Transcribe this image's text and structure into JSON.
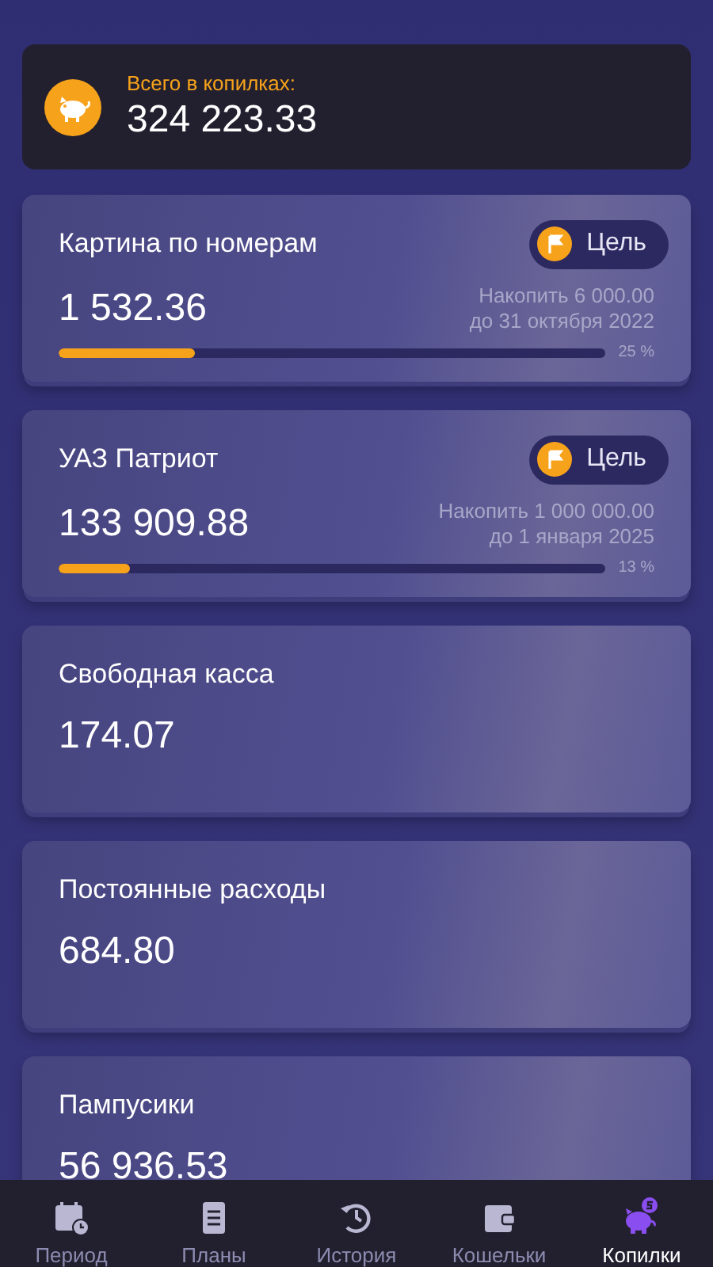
{
  "total": {
    "label": "Всего в копилках:",
    "amount": "324 223.33"
  },
  "jars": [
    {
      "kind": "goal",
      "name": "Картина по номерам",
      "badge": "Цель",
      "amount": "1 532.36",
      "target": "Накопить 6 000.00",
      "deadline": "до 31 октября 2022",
      "level": 0.25,
      "percent": "25 %"
    },
    {
      "kind": "goal",
      "name": "УАЗ Патриот",
      "badge": "Цель",
      "amount": "133 909.88",
      "target": "Накопить 1 000 000.00",
      "deadline": "до 1 января 2025",
      "level": 0.13,
      "percent": "13 %"
    },
    {
      "kind": "plain",
      "name": "Свободная касса",
      "amount": "174.07"
    },
    {
      "kind": "plain",
      "name": "Постоянные расходы",
      "amount": "684.80"
    },
    {
      "kind": "plain",
      "name": "Пампусики",
      "amount": "56 936.53"
    }
  ],
  "nav": [
    {
      "kind": "calendar",
      "label": "Период",
      "selected": false
    },
    {
      "kind": "document",
      "label": "Планы",
      "selected": false
    },
    {
      "kind": "history",
      "label": "История",
      "selected": false
    },
    {
      "kind": "wallet",
      "label": "Кошельки",
      "selected": false
    },
    {
      "kind": "piggy",
      "label": "Копилки",
      "selected": true
    }
  ]
}
